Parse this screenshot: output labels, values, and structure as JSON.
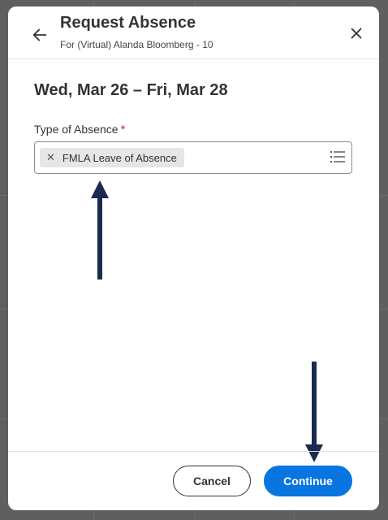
{
  "dialog": {
    "title": "Request Absence",
    "subtitle": "For (Virtual) Alanda Bloomberg - 10"
  },
  "date_range": "Wed, Mar 26 – Fri, Mar 28",
  "type_of_absence": {
    "label": "Type of Absence",
    "required_mark": "*",
    "selected": [
      {
        "remove_glyph": "✕",
        "label": "FMLA Leave of Absence"
      }
    ]
  },
  "footer": {
    "cancel_label": "Cancel",
    "continue_label": "Continue"
  },
  "icons": {
    "back": "arrow-left-icon",
    "close": "close-icon",
    "list": "list-icon",
    "remove": "remove-x-icon"
  },
  "colors": {
    "primary": "#0875e1",
    "required": "#d9262b",
    "annotation_arrow": "#1b2a4e"
  }
}
